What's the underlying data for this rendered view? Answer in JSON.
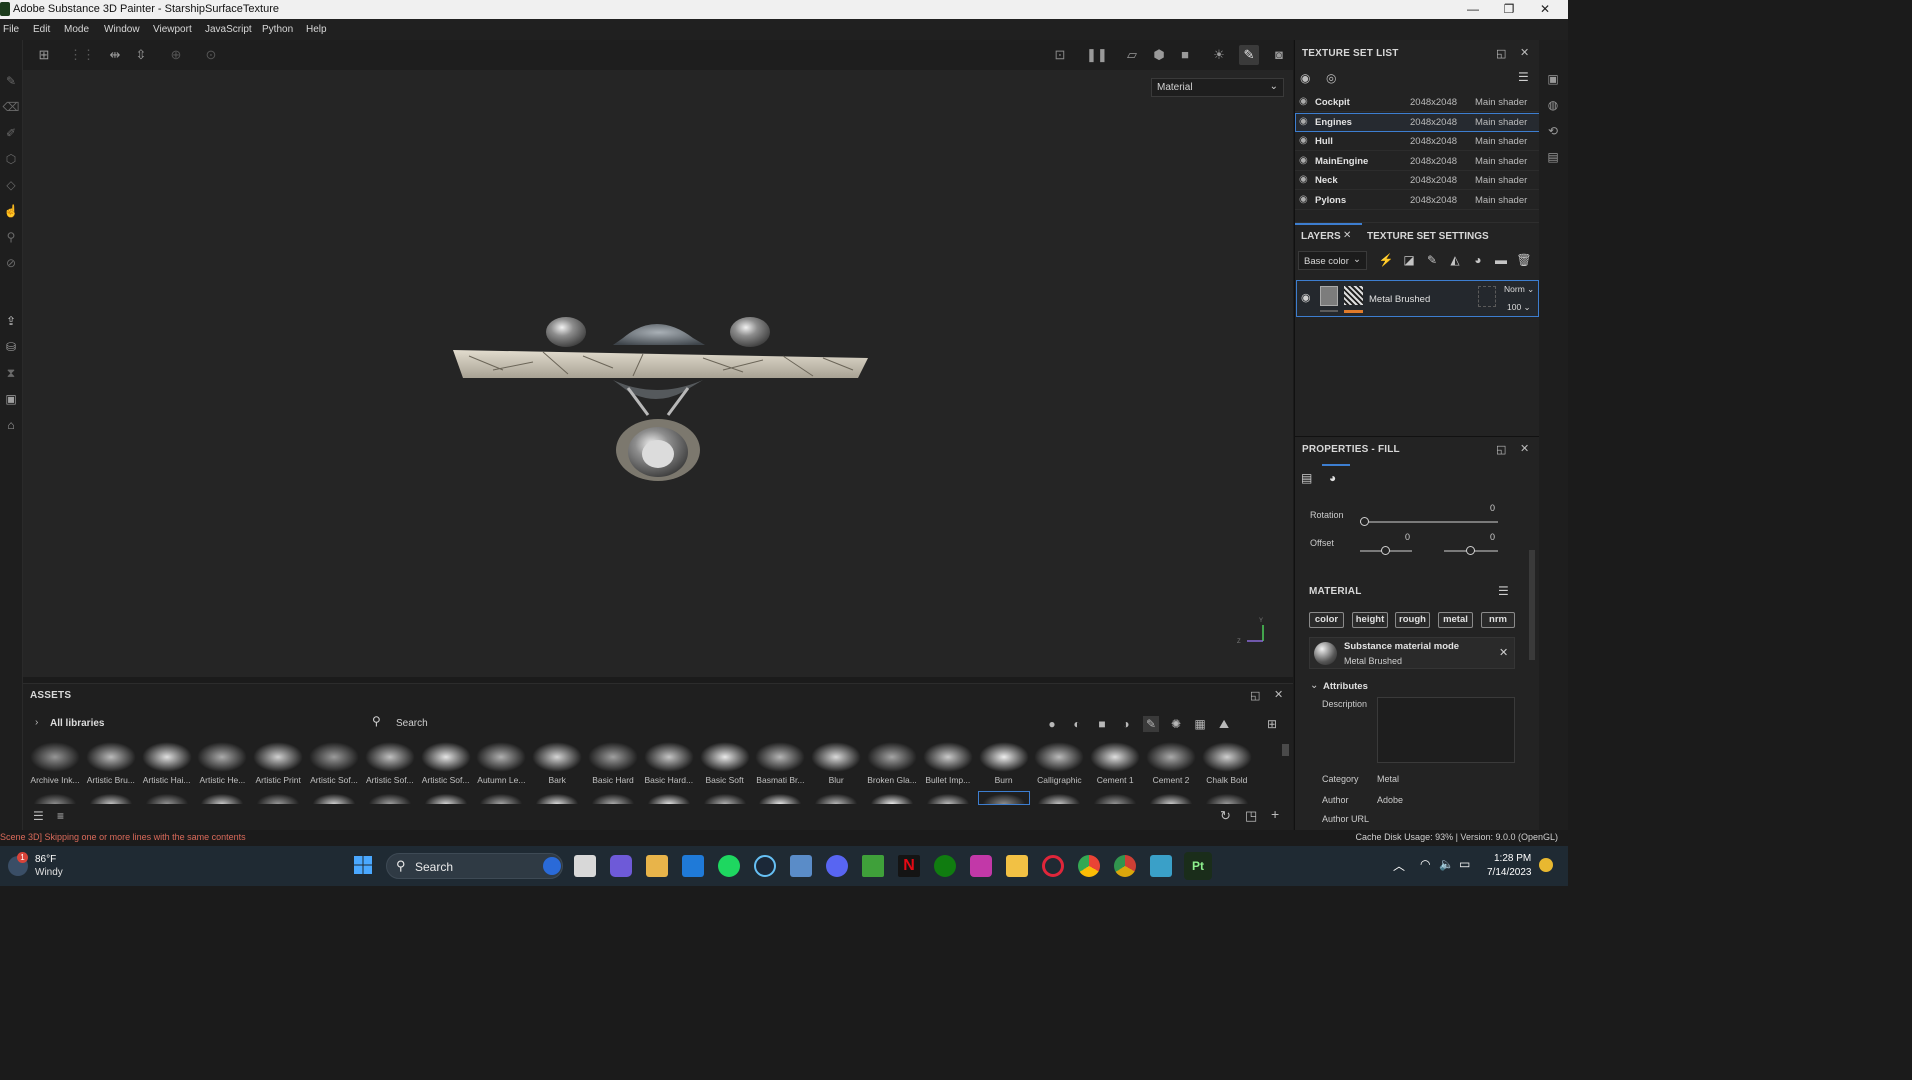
{
  "window": {
    "title": "Adobe Substance 3D Painter - StarshipSurfaceTexture",
    "minimize_glyph": "—",
    "maximize_glyph": "❐",
    "close_glyph": "✕"
  },
  "menu": [
    "File",
    "Edit",
    "Mode",
    "Window",
    "Viewport",
    "JavaScript",
    "Python",
    "Help"
  ],
  "viewport": {
    "channel_select": "Material",
    "axis_y": "Y",
    "axis_z": "Z"
  },
  "texture_set_list": {
    "title": "TEXTURE SET LIST",
    "rows": [
      {
        "name": "Cockpit",
        "resolution": "2048x2048",
        "shader": "Main shader"
      },
      {
        "name": "Engines",
        "resolution": "2048x2048",
        "shader": "Main shader"
      },
      {
        "name": "Hull",
        "resolution": "2048x2048",
        "shader": "Main shader"
      },
      {
        "name": "MainEngine",
        "resolution": "2048x2048",
        "shader": "Main shader"
      },
      {
        "name": "Neck",
        "resolution": "2048x2048",
        "shader": "Main shader"
      },
      {
        "name": "Pylons",
        "resolution": "2048x2048",
        "shader": "Main shader"
      }
    ],
    "selected": "Engines"
  },
  "layers": {
    "tab_layers": "LAYERS",
    "tab_settings": "TEXTURE SET SETTINGS",
    "channel": "Base color",
    "layer_name": "Metal Brushed",
    "blend_mode": "Norm",
    "opacity": "100"
  },
  "properties": {
    "title": "PROPERTIES - FILL",
    "rotation_label": "Rotation",
    "rotation_value": "0",
    "offset_label": "Offset",
    "offset_x": "0",
    "offset_y": "0",
    "material_section": "MATERIAL",
    "channels": [
      "color",
      "height",
      "rough",
      "metal",
      "nrm"
    ],
    "mode_title": "Substance material mode",
    "mode_material": "Metal Brushed",
    "attributes_label": "Attributes",
    "description_label": "Description",
    "category_label": "Category",
    "category_value": "Metal",
    "author_label": "Author",
    "author_value": "Adobe",
    "author_url_label": "Author URL"
  },
  "assets": {
    "title": "ASSETS",
    "library": "All libraries",
    "search_placeholder": "Search",
    "items": [
      "Archive Ink...",
      "Artistic Bru...",
      "Artistic Hai...",
      "Artistic He...",
      "Artistic Print",
      "Artistic Sof...",
      "Artistic Sof...",
      "Artistic Sof...",
      "Autumn Le...",
      "Bark",
      "Basic Hard",
      "Basic Hard...",
      "Basic Soft",
      "Basmati Br...",
      "Blur",
      "Broken Gla...",
      "Bullet Imp...",
      "Burn",
      "Calligraphic",
      "Cement 1",
      "Cement 2",
      "Chalk Bold"
    ]
  },
  "status": {
    "message": "Scene 3D] Skipping one or more lines with the same contents",
    "right": "Cache Disk Usage:   93% | Version: 9.0.0 (OpenGL)"
  },
  "taskbar": {
    "weather_temp": "86°F",
    "weather_desc": "Windy",
    "weather_badge": "1",
    "search_label": "Search",
    "time": "1:28 PM",
    "date": "7/14/2023",
    "app_label": "Pt"
  },
  "colors": {
    "accent_blue": "#3d7ed0",
    "accent_orange": "#e07a2a",
    "status_error": "#d96a5a"
  }
}
